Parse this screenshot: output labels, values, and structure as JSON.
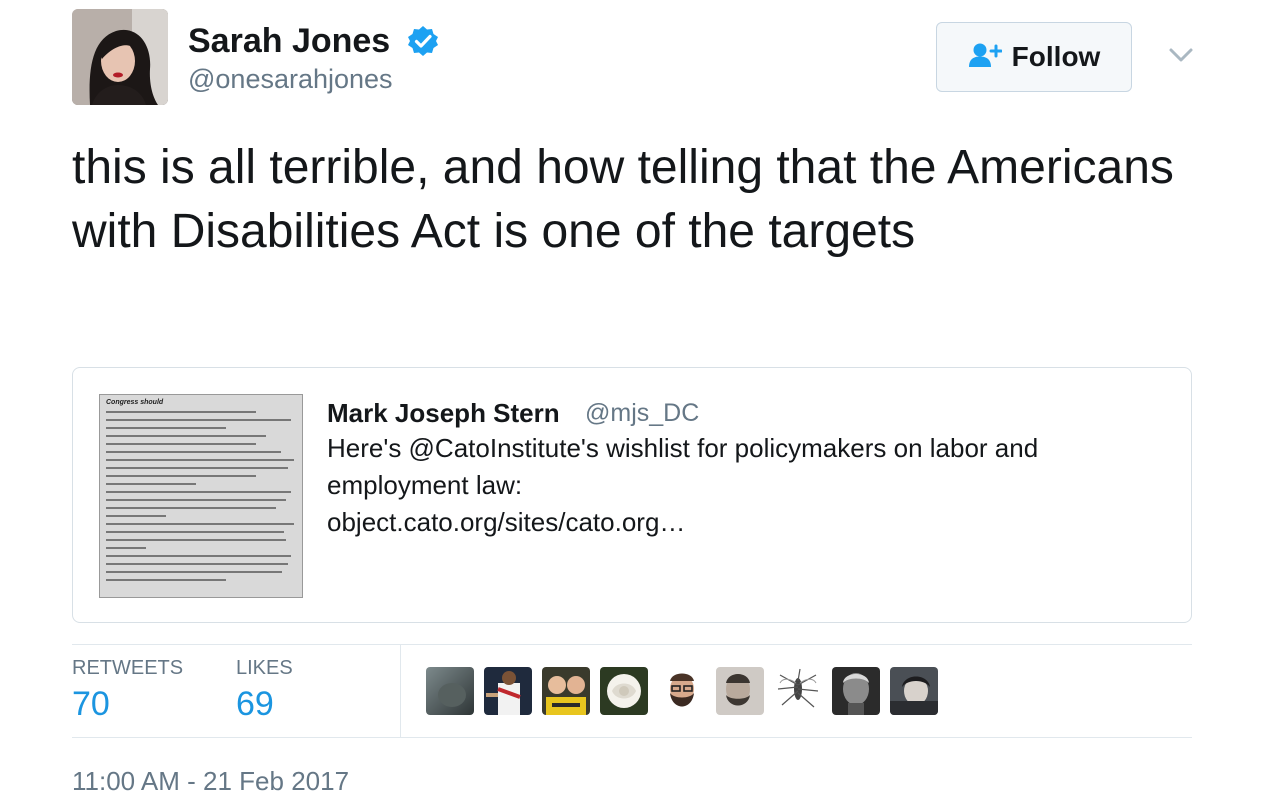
{
  "author": {
    "display_name": "Sarah Jones",
    "handle": "@onesarahjones",
    "verified": true,
    "avatar_icon": "profile-photo"
  },
  "follow_button": {
    "label": "Follow",
    "icon": "add-user-icon"
  },
  "more_menu": {
    "icon": "chevron-down-icon"
  },
  "tweet": {
    "text": "this is all terrible, and how telling that the Americans with Disabilities Act is one of the targets"
  },
  "quoted_tweet": {
    "author_name": "Mark Joseph Stern",
    "author_handle": "@mjs_DC",
    "text_line1": "Here's @CatoInstitute's wishlist for policymakers on labor and",
    "text_line2": "employment law:",
    "link": "object.cato.org/sites/cato.org…",
    "thumbnail": {
      "heading": "Congress should",
      "description": "document-excerpt-image"
    }
  },
  "stats": {
    "retweets_label": "RETWEETS",
    "retweets_count": "70",
    "likes_label": "LIKES",
    "likes_count": "69"
  },
  "favoriters": [
    {
      "icon": "user-avatar-1"
    },
    {
      "icon": "user-avatar-2"
    },
    {
      "icon": "user-avatar-3"
    },
    {
      "icon": "user-avatar-4"
    },
    {
      "icon": "user-avatar-5"
    },
    {
      "icon": "user-avatar-6"
    },
    {
      "icon": "user-avatar-7"
    },
    {
      "icon": "user-avatar-8"
    },
    {
      "icon": "user-avatar-9"
    }
  ],
  "timestamp": "11:00 AM - 21 Feb 2017",
  "colors": {
    "link_blue": "#1b95e0",
    "verified_blue": "#1da1f2",
    "text_dark": "#14171a",
    "text_gray": "#657786"
  }
}
